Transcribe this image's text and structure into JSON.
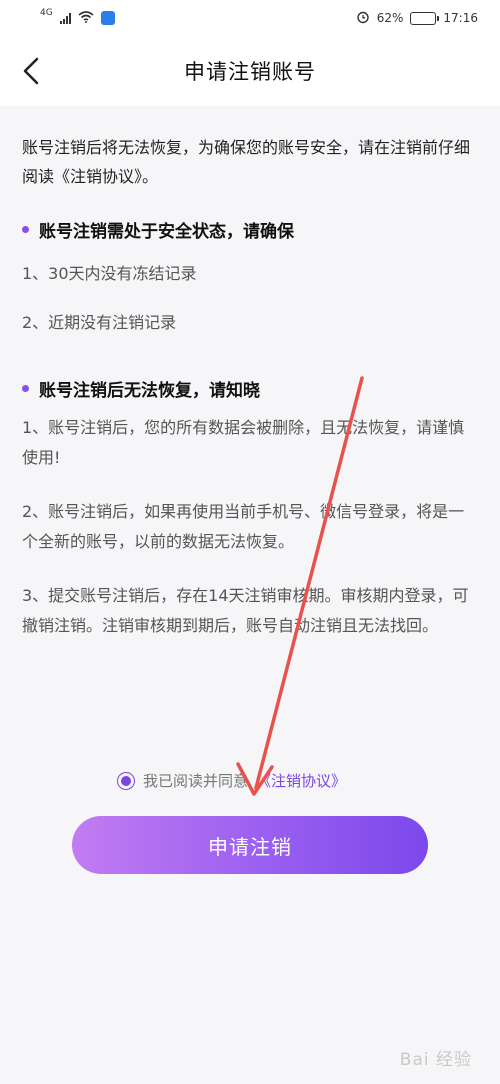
{
  "status_bar": {
    "network": "4G",
    "battery_text": "62%",
    "battery_level": 0.62,
    "time": "17:16"
  },
  "header": {
    "title": "申请注销账号"
  },
  "intro": "账号注销后将无法恢复，为确保您的账号安全，请在注销前仔细阅读《注销协议》。",
  "sections": [
    {
      "heading": "账号注销需处于安全状态，请确保",
      "items": [
        "1、30天内没有冻结记录",
        "2、近期没有注销记录"
      ]
    },
    {
      "heading": "账号注销后无法恢复，请知晓",
      "items": [
        "1、账号注销后，您的所有数据会被删除，且无法恢复，请谨慎使用!",
        "2、账号注销后，如果再使用当前手机号、微信号登录，将是一个全新的账号，以前的数据无法恢复。",
        "3、提交账号注销后，存在14天注销审核期。审核期内登录，可撤销注销。注销审核期到期后，账号自动注销且无法找回。"
      ]
    }
  ],
  "agreement": {
    "checked": true,
    "text": "我已阅读并同意",
    "link": "《注销协议》"
  },
  "submit_label": "申请注销",
  "watermark": "Bai 经验",
  "colors": {
    "accent": "#7b45e3",
    "annotation_arrow": "#e8524a"
  }
}
